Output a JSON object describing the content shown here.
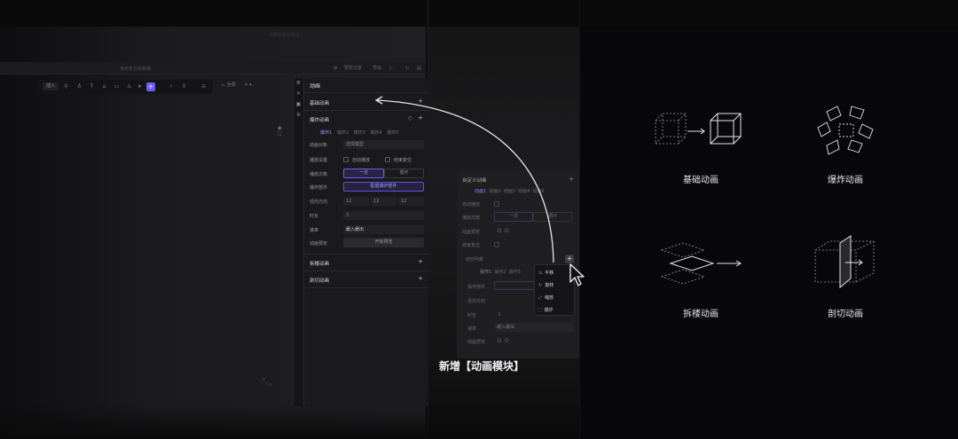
{
  "window": {
    "app_title": "大屏数据可视化",
    "sub_title": "未命名分组系统"
  },
  "titlebar_buttons": [
    "预览分享",
    "导出"
  ],
  "toolbar": {
    "input_label": "插入",
    "view_label": "全局"
  },
  "panel": {
    "header": "动画",
    "basic_section": "基础动画",
    "action_section": "爆炸动画",
    "tabs": [
      "爆炸1",
      "爆炸2",
      "爆炸3",
      "爆炸4",
      "爆炸5"
    ],
    "rows": {
      "target_label": "动画对象",
      "target_placeholder": "选择模型",
      "play_label": "播放设置",
      "auto_play": "自动播放",
      "reset_end": "结束复位",
      "count_label": "播放次数",
      "count_once": "一次",
      "count_loop": "循环",
      "parts_label": "爆炸部件",
      "parts_button": "配置爆炸部件",
      "direction_label": "径向方向",
      "dir_x": "12",
      "dir_y": "12",
      "dir_z": "12",
      "duration_label": "时长",
      "duration_value": "3",
      "speed_label": "速率",
      "speed_value": "缓入缓出",
      "preview_label": "动画预览",
      "preview_button": "开始预览"
    },
    "split_section": "拆楼动画",
    "cut_section": "剖切动画"
  },
  "mid_panel": {
    "title": "自定义动画",
    "tabs": [
      "动画1",
      "动画2",
      "动画3",
      "动画4",
      "动画5"
    ],
    "rows": [
      "自动播放",
      "播放次数",
      "动画预览",
      "结束复位"
    ],
    "count_once": "一次",
    "count_loop": "循环",
    "action_list": "动作列表",
    "sub_tabs": [
      "操作1",
      "操作2",
      "操作3"
    ],
    "parts_label": "操作部件",
    "direction_label": "径向方向",
    "duration_label": "时长",
    "duration_value": "3",
    "speed_label": "速率",
    "speed_value": "缓入缓出",
    "preview_label": "动画预览"
  },
  "menu": {
    "items": [
      {
        "icon": "⇆",
        "label": "平移"
      },
      {
        "icon": "↻",
        "label": "旋转"
      },
      {
        "icon": "⤢",
        "label": "缩放"
      },
      {
        "icon": "⛶",
        "label": "爆炸"
      }
    ]
  },
  "caption": "新增【动画模块】",
  "showcase": {
    "basic": "基础动画",
    "explode": "爆炸动画",
    "split": "拆楼动画",
    "cut": "剖切动画"
  },
  "colors": {
    "accent": "#6b5cff",
    "bg": "#08080a"
  }
}
